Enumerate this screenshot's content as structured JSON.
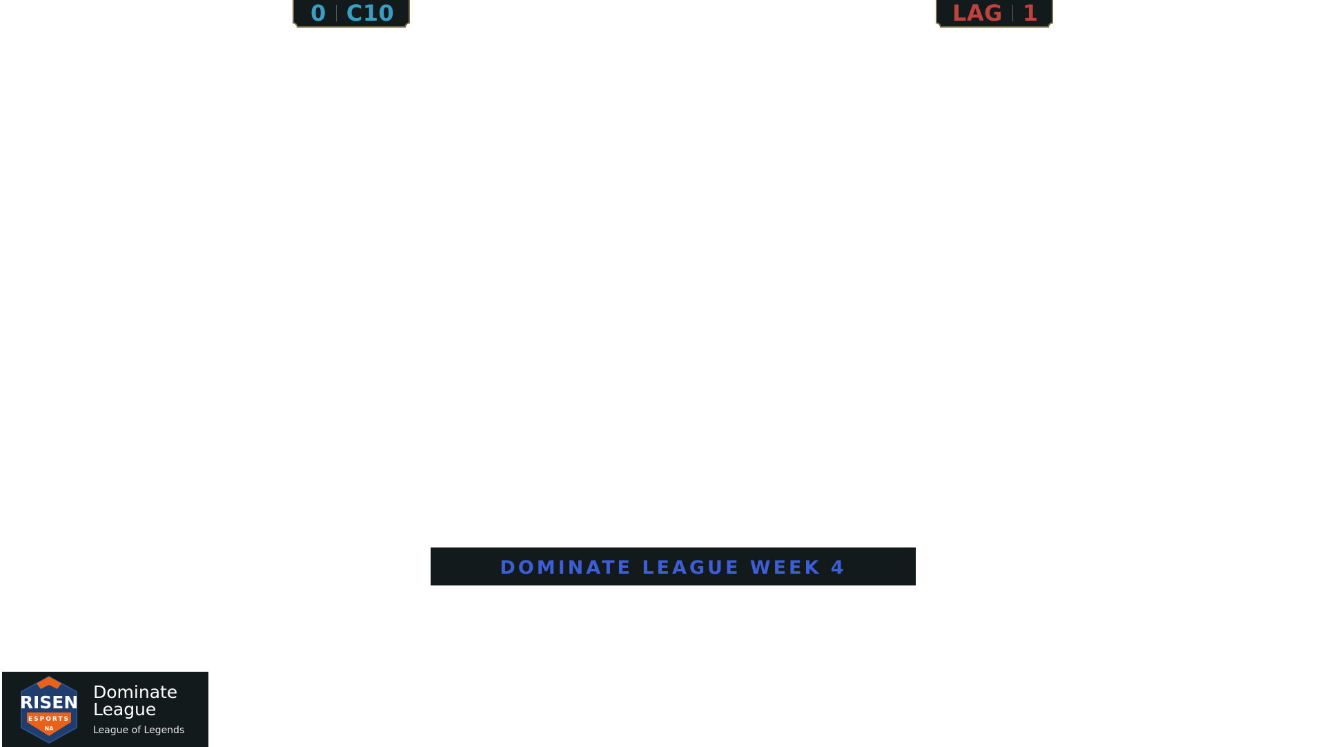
{
  "scoreboard": {
    "left": {
      "score": "0",
      "team": "C10"
    },
    "right": {
      "team": "LAG",
      "score": "1"
    }
  },
  "banner": {
    "label": "DOMINATE LEAGUE WEEK 4"
  },
  "logo_card": {
    "logo_word": "RISEN",
    "logo_sub": "ESPORTS",
    "logo_region": "NA",
    "title_line1": "Dominate",
    "title_line2": "League",
    "subtitle": "League of Legends"
  },
  "colors": {
    "panel": "#131a1b",
    "blue_team": "#3b9dc4",
    "red_team": "#c0423f",
    "banner_text": "#3e5ed8",
    "accent_gold": "#7a6a44",
    "logo_orange": "#e8621a",
    "logo_navy": "#1f3d6e"
  }
}
